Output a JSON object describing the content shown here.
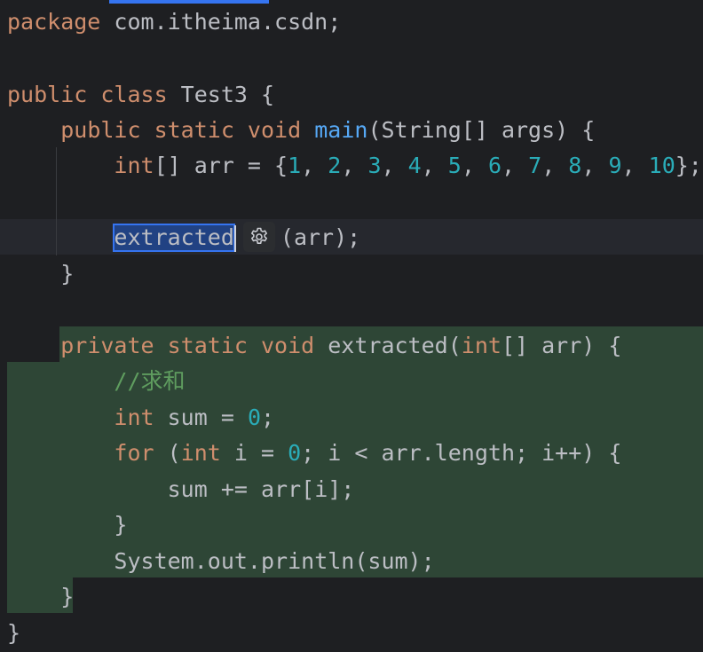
{
  "code": {
    "package_kw": "package",
    "package_name": " com.itheima.csdn;",
    "class_kw": "public class",
    "class_name": " Test3 {",
    "main_kw": "public static void",
    "main_name": "main",
    "main_params": "(String[] args) {",
    "arr_type": "int",
    "arr_decl": "[] arr = {",
    "arr_values": [
      "1",
      "2",
      "3",
      "4",
      "5",
      "6",
      "7",
      "8",
      "9",
      "10"
    ],
    "arr_end": "};",
    "call_name": "extracted",
    "call_args": "(arr);",
    "close_brace": "}",
    "method_kw": "private static void",
    "method_name": " extracted(",
    "method_param_type": "int",
    "method_param_rest": "[] arr) {",
    "comment": "//求和",
    "sum_type": "int",
    "sum_decl": " sum = ",
    "sum_init": "0",
    "semicolon": ";",
    "for_kw": "for",
    "for_open": " (",
    "for_type": "int",
    "for_var": " i = ",
    "for_init": "0",
    "for_rest": "; i < arr.length; i++) {",
    "sum_add": "sum += arr[i];",
    "println": "System.out.println(sum);"
  },
  "icons": {
    "gear": "gear-icon"
  },
  "colors": {
    "background": "#1e1f22",
    "keyword": "#cf8e6d",
    "number": "#2aacb8",
    "function": "#56a8f5",
    "comment": "#5f9d5f",
    "extracted_highlight": "#2e4636",
    "selection": "#214283"
  }
}
